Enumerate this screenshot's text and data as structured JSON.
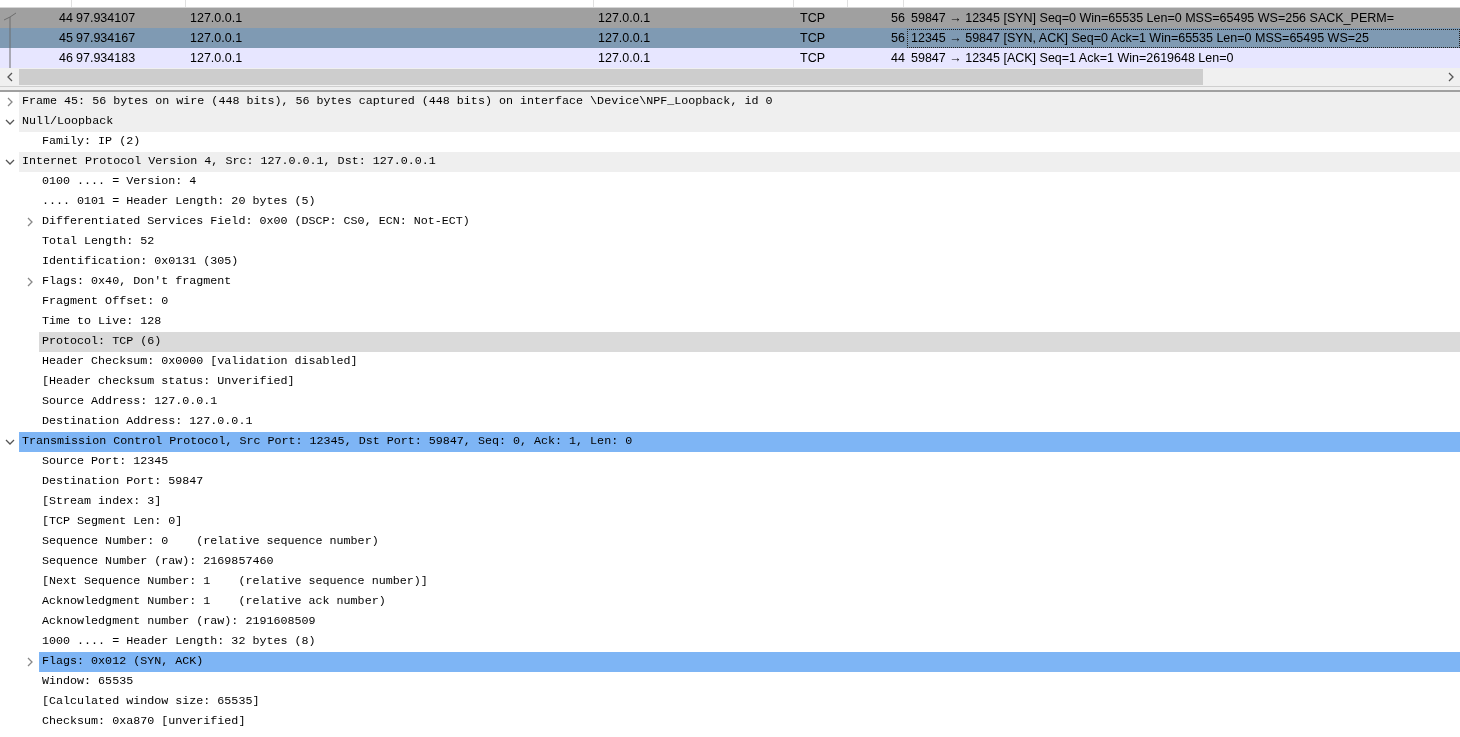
{
  "packet_list": {
    "rows": [
      {
        "no": "44",
        "time": "97.934107",
        "source": "127.0.0.1",
        "destination": "127.0.0.1",
        "protocol": "TCP",
        "length": "56",
        "info": "59847 → 12345 [SYN] Seq=0 Win=65535 Len=0 MSS=65495 WS=256 SACK_PERM=",
        "selected": false,
        "related_mark": true
      },
      {
        "no": "45",
        "time": "97.934167",
        "source": "127.0.0.1",
        "destination": "127.0.0.1",
        "protocol": "TCP",
        "length": "56",
        "info": "12345 → 59847 [SYN, ACK] Seq=0 Ack=1 Win=65535 Len=0 MSS=65495 WS=25",
        "selected": true,
        "related_mark": false
      },
      {
        "no": "46",
        "time": "97.934183",
        "source": "127.0.0.1",
        "destination": "127.0.0.1",
        "protocol": "TCP",
        "length": "44",
        "info": "59847 → 12345 [ACK] Seq=1 Ack=1 Win=2619648 Len=0",
        "selected": false,
        "related_mark": false
      }
    ]
  },
  "details": [
    {
      "text": "Frame 45: 56 bytes on wire (448 bits), 56 bytes captured (448 bits) on interface \\Device\\NPF_Loopback, id 0",
      "expanded": false,
      "selected": false
    },
    {
      "text": "Null/Loopback",
      "expanded": true,
      "selected": false,
      "children": [
        {
          "text": "Family: IP (2)"
        }
      ]
    },
    {
      "text": "Internet Protocol Version 4, Src: 127.0.0.1, Dst: 127.0.0.1",
      "expanded": true,
      "selected": false,
      "children": [
        {
          "text": "0100 .... = Version: 4"
        },
        {
          "text": ".... 0101 = Header Length: 20 bytes (5)"
        },
        {
          "text": "Differentiated Services Field: 0x00 (DSCP: CS0, ECN: Not-ECT)",
          "expanded": false
        },
        {
          "text": "Total Length: 52"
        },
        {
          "text": "Identification: 0x0131 (305)"
        },
        {
          "text": "Flags: 0x40, Don't fragment",
          "expanded": false
        },
        {
          "text": "Fragment Offset: 0"
        },
        {
          "text": "Time to Live: 128"
        },
        {
          "text": "Protocol: TCP (6)",
          "related": true
        },
        {
          "text": "Header Checksum: 0x0000 [validation disabled]"
        },
        {
          "text": "[Header checksum status: Unverified]"
        },
        {
          "text": "Source Address: 127.0.0.1"
        },
        {
          "text": "Destination Address: 127.0.0.1"
        }
      ]
    },
    {
      "text": "Transmission Control Protocol, Src Port: 12345, Dst Port: 59847, Seq: 0, Ack: 1, Len: 0",
      "expanded": true,
      "selected": true,
      "children": [
        {
          "text": "Source Port: 12345"
        },
        {
          "text": "Destination Port: 59847"
        },
        {
          "text": "[Stream index: 3]"
        },
        {
          "text": "[TCP Segment Len: 0]"
        },
        {
          "text": "Sequence Number: 0    (relative sequence number)"
        },
        {
          "text": "Sequence Number (raw): 2169857460"
        },
        {
          "text": "[Next Sequence Number: 1    (relative sequence number)]"
        },
        {
          "text": "Acknowledgment Number: 1    (relative ack number)"
        },
        {
          "text": "Acknowledgment number (raw): 2191608509"
        },
        {
          "text": "1000 .... = Header Length: 32 bytes (8)"
        },
        {
          "text": "Flags: 0x012 (SYN, ACK)",
          "expanded": false,
          "selected": true
        },
        {
          "text": "Window: 65535"
        },
        {
          "text": "[Calculated window size: 65535]"
        },
        {
          "text": "Checksum: 0xa870 [unverified]"
        }
      ]
    }
  ]
}
